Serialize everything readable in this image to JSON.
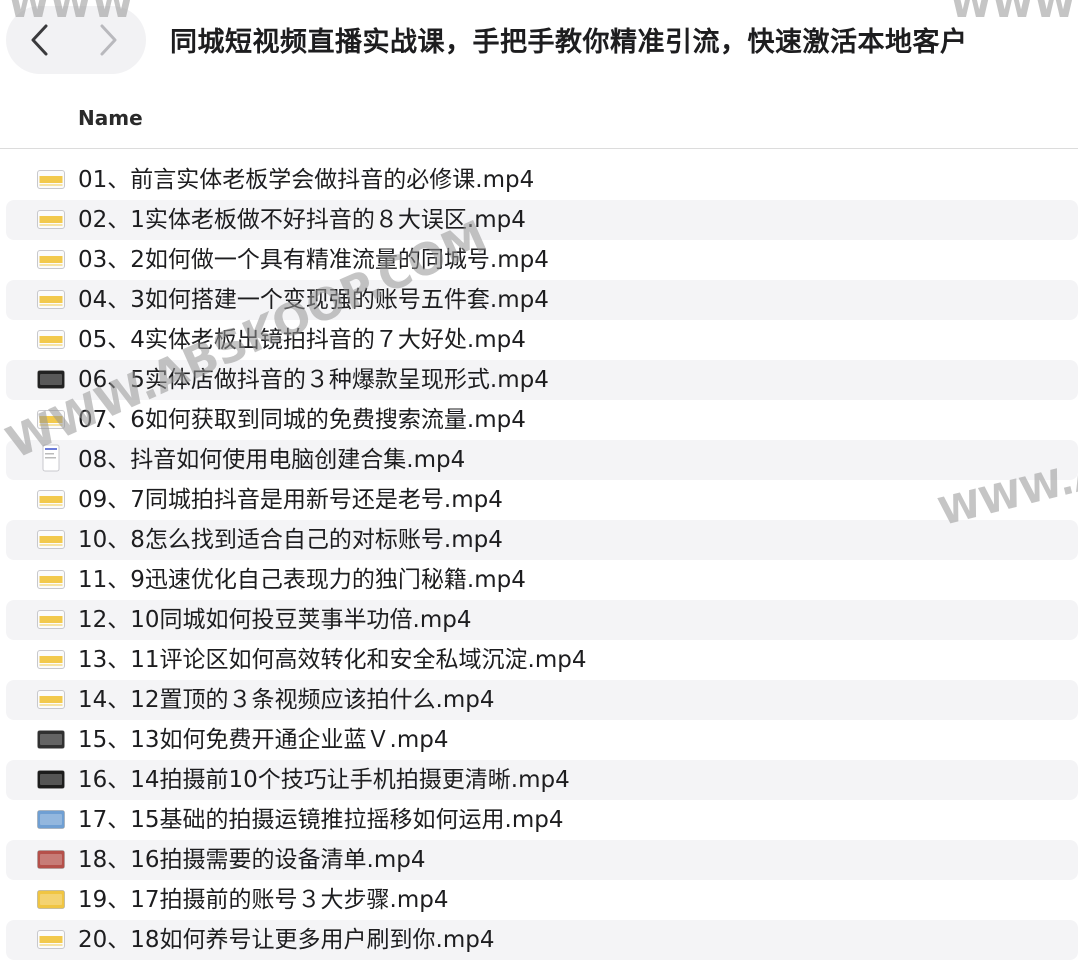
{
  "window": {
    "title": "同城短视频直播实战课，手把手教你精准引流，快速激活本地客户",
    "back_icon": "chevron-left-icon",
    "forward_icon": "chevron-right-icon"
  },
  "columns": {
    "name": "Name"
  },
  "files": [
    {
      "name": "01、前言实体老板学会做抖音的必修课.mp4",
      "icon": "video-file-icon"
    },
    {
      "name": "02、1实体老板做不好抖音的８大误区.mp4",
      "icon": "video-file-icon"
    },
    {
      "name": "03、2如何做一个具有精准流量的同城号.mp4",
      "icon": "video-file-icon"
    },
    {
      "name": "04、3如何搭建一个变现强的账号五件套.mp4",
      "icon": "video-file-icon"
    },
    {
      "name": "05、4实体老板出镜拍抖音的７大好处.mp4",
      "icon": "video-file-icon"
    },
    {
      "name": "06、5实体店做抖音的３种爆款呈现形式.mp4",
      "icon": "video-thumbnail-icon"
    },
    {
      "name": "07、6如何获取到同城的免费搜索流量.mp4",
      "icon": "video-file-icon"
    },
    {
      "name": "08、抖音如何使用电脑创建合集.mp4",
      "icon": "document-thumbnail-icon"
    },
    {
      "name": "09、7同城拍抖音是用新号还是老号.mp4",
      "icon": "video-file-icon"
    },
    {
      "name": "10、8怎么找到适合自己的对标账号.mp4",
      "icon": "video-file-icon"
    },
    {
      "name": "11、9迅速优化自己表现力的独门秘籍.mp4",
      "icon": "video-file-icon"
    },
    {
      "name": "12、10同城如何投豆荚事半功倍.mp4",
      "icon": "video-file-icon"
    },
    {
      "name": "13、11评论区如何高效转化和安全私域沉淀.mp4",
      "icon": "video-file-icon"
    },
    {
      "name": "14、12置顶的３条视频应该拍什么.mp4",
      "icon": "video-file-icon"
    },
    {
      "name": "15、13如何免费开通企业蓝Ｖ.mp4",
      "icon": "video-thumbnail-icon"
    },
    {
      "name": "16、14拍摄前10个技巧让手机拍摄更清晰.mp4",
      "icon": "video-thumbnail-icon"
    },
    {
      "name": "17、15基础的拍摄运镜推拉摇移如何运用.mp4",
      "icon": "video-thumbnail-icon"
    },
    {
      "name": "18、16拍摄需要的设备清单.mp4",
      "icon": "video-thumbnail-icon"
    },
    {
      "name": "19、17拍摄前的账号３大步骤.mp4",
      "icon": "video-thumbnail-icon"
    },
    {
      "name": "20、18如何养号让更多用户刷到你.mp4",
      "icon": "video-file-icon"
    }
  ],
  "watermarks": {
    "top_left": "WWW",
    "top_right": "WWW",
    "middle": "WWW.ABSKOOP.COM",
    "right": "WWW.A"
  },
  "colors": {
    "row_stripe": "#f4f4f6",
    "icon_yellow": "#f2c94c"
  }
}
